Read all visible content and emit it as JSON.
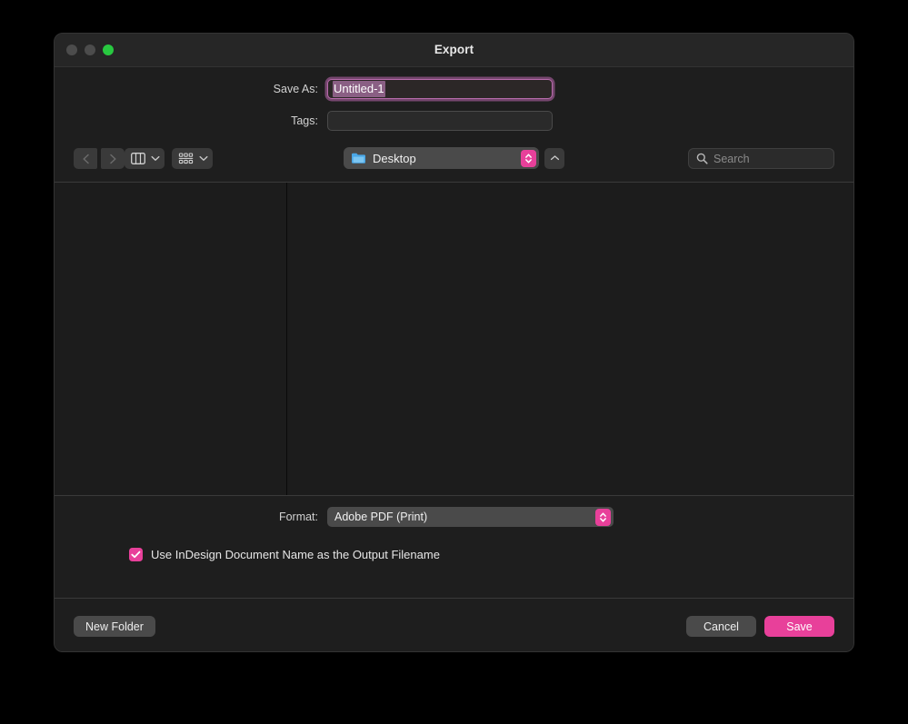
{
  "window": {
    "title": "Export",
    "traffic_lights": [
      {
        "name": "close-button",
        "color": "#4c4c4c"
      },
      {
        "name": "minimize-button",
        "color": "#4c4c4c"
      },
      {
        "name": "zoom-button",
        "color": "#28c840"
      }
    ]
  },
  "form": {
    "save_as_label": "Save As:",
    "save_as_value": "Untitled-1",
    "tags_label": "Tags:",
    "tags_value": "",
    "tags_placeholder": ""
  },
  "toolbar": {
    "back_icon": "chevron-left-icon",
    "forward_icon": "chevron-right-icon",
    "view_icon": "column-view-icon",
    "group_icon": "group-by-grid-icon",
    "view_chevron": "chevron-down-icon",
    "group_chevron": "chevron-down-icon",
    "path_label": "Desktop",
    "path_folder_icon": "folder-icon",
    "path_stepper_icon": "stepper-up-down-icon",
    "up_icon": "chevron-up-icon",
    "search_icon": "search-icon",
    "search_placeholder": "Search",
    "search_value": ""
  },
  "browser": {
    "column_one_items": [],
    "column_two_items": []
  },
  "options": {
    "format_label": "Format:",
    "format_value": "Adobe PDF (Print)",
    "format_stepper_icon": "stepper-up-down-icon",
    "checkbox_checked": true,
    "checkbox_icon": "checkmark-icon",
    "checkbox_label": "Use InDesign Document Name as the Output Filename"
  },
  "footer": {
    "new_folder_label": "New Folder",
    "cancel_label": "Cancel",
    "save_label": "Save"
  },
  "colors": {
    "accent_pink": "#e8409a",
    "zoom_green": "#28c840",
    "window_bg": "#1e1e1e",
    "browser_bg": "#1c1c1c",
    "titlebar_bg": "#262626",
    "control_gray": "#4a4a4a",
    "folder_blue": "#4aa8e8"
  }
}
